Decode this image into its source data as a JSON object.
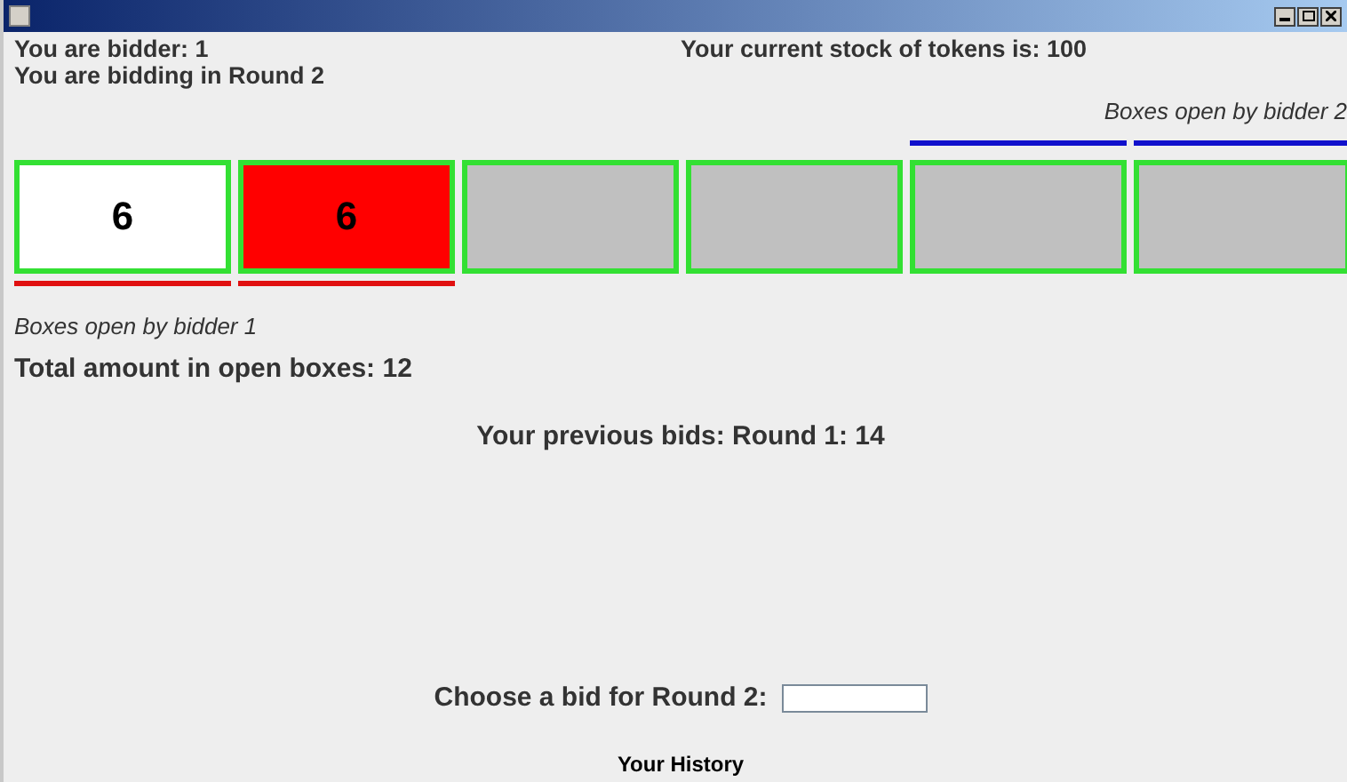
{
  "header": {
    "bidder": "You are bidder: 1",
    "round": "You are bidding in Round 2",
    "stock": "Your current stock of tokens is: 100"
  },
  "caption_top": "Boxes open by bidder 2",
  "boxes": [
    {
      "kind": "open",
      "value": "6",
      "bidder1_open": true,
      "bidder2_open": false
    },
    {
      "kind": "highlighted",
      "value": "6",
      "bidder1_open": true,
      "bidder2_open": false
    },
    {
      "kind": "closed",
      "bidder1_open": false,
      "bidder2_open": false
    },
    {
      "kind": "closed",
      "bidder1_open": false,
      "bidder2_open": false
    },
    {
      "kind": "closed",
      "bidder1_open": false,
      "bidder2_open": true
    },
    {
      "kind": "closed",
      "bidder1_open": false,
      "bidder2_open": true
    }
  ],
  "caption_bottom": "Boxes open by bidder 1",
  "total": "Total amount in open boxes: 12",
  "previous": "Your previous bids:  Round 1: 14",
  "bid_label": "Choose a bid for Round 2:",
  "history_title": "Your History"
}
